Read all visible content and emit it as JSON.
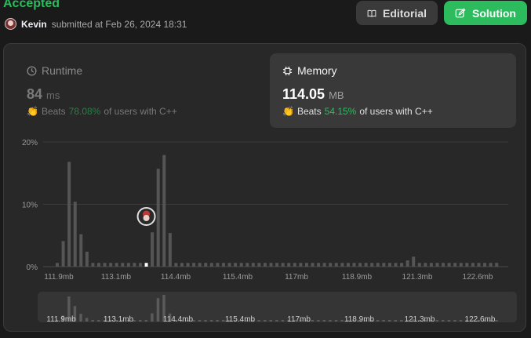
{
  "header": {
    "status": "Accepted",
    "user": "Kevin",
    "submitted_text": "submitted at Feb 26, 2024 18:31"
  },
  "buttons": {
    "editorial": "Editorial",
    "solution": "Solution"
  },
  "runtime": {
    "label": "Runtime",
    "value": "84",
    "unit": "ms",
    "beats_label": "Beats",
    "beats_pct": "78.08%",
    "beats_suffix": "of users with C++"
  },
  "memory": {
    "label": "Memory",
    "value": "114.05",
    "unit": "MB",
    "beats_label": "Beats",
    "beats_pct": "54.15%",
    "beats_suffix": "of users with C++"
  },
  "colors": {
    "accent_green": "#2cbb5d",
    "bar": "#555555",
    "highlight_bar": "#ffffff"
  },
  "chart_data": {
    "type": "bar",
    "ylim": [
      0,
      20
    ],
    "y_ticks": [
      "20%",
      "10%",
      "0%"
    ],
    "x_ticks": [
      "111.9mb",
      "113.1mb",
      "114.4mb",
      "115.4mb",
      "117mb",
      "118.9mb",
      "121.3mb",
      "122.6mb"
    ],
    "values": [
      0.6,
      4.1,
      16.8,
      10.4,
      5.2,
      2.4,
      0.6,
      0.6,
      0.6,
      0.6,
      0.6,
      0.6,
      0.6,
      0.6,
      0.6,
      0.6,
      5.5,
      15.7,
      17.9,
      5.4,
      0.6,
      0.6,
      0.6,
      0.6,
      0.6,
      0.6,
      0.6,
      0.6,
      0.6,
      0.6,
      0.6,
      0.6,
      0.6,
      0.6,
      0.6,
      0.6,
      0.6,
      0.6,
      0.6,
      0.6,
      0.6,
      0.6,
      0.6,
      0.6,
      0.6,
      0.6,
      0.6,
      0.6,
      0.6,
      0.6,
      0.6,
      0.6,
      0.6,
      0.6,
      0.6,
      0.6,
      0.6,
      0.6,
      0.6,
      1.0,
      1.6,
      0.6,
      0.6,
      0.6,
      0.6,
      0.6,
      0.6,
      0.6,
      0.6,
      0.6,
      0.6,
      0.6,
      0.6,
      0.6,
      0.6
    ],
    "highlight_index": 15,
    "highlight_value": "114.05",
    "grid": true
  }
}
